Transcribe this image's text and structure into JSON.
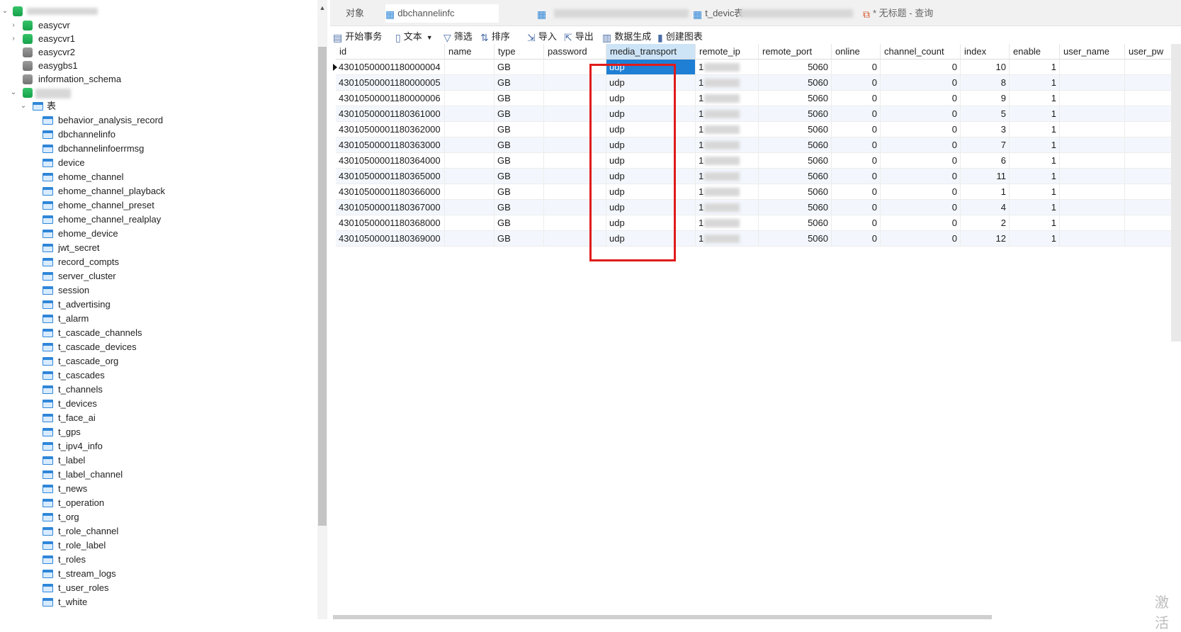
{
  "tabs": [
    {
      "label": "对象"
    },
    {
      "label": "dbchannelinfc"
    },
    {
      "label": "表"
    },
    {
      "label": "t_devic"
    },
    {
      "label": "* 无标题 - 查询"
    }
  ],
  "toolbar": {
    "begin_transaction": "开始事务",
    "text": "文本",
    "filter": "筛选",
    "sort": "排序",
    "import": "导入",
    "export": "导出",
    "generate_data": "数据生成",
    "create_chart": "创建图表"
  },
  "tree": {
    "databases": [
      "easycvr",
      "easycvr1",
      "easycvr2",
      "easygbs1",
      "information_schema"
    ],
    "tables_node": "表",
    "tables": [
      "behavior_analysis_record",
      "dbchannelinfo",
      "dbchannelinfoerrmsg",
      "device",
      "ehome_channel",
      "ehome_channel_playback",
      "ehome_channel_preset",
      "ehome_channel_realplay",
      "ehome_device",
      "jwt_secret",
      "record_compts",
      "server_cluster",
      "session",
      "t_advertising",
      "t_alarm",
      "t_cascade_channels",
      "t_cascade_devices",
      "t_cascade_org",
      "t_cascades",
      "t_channels",
      "t_devices",
      "t_face_ai",
      "t_gps",
      "t_ipv4_info",
      "t_label",
      "t_label_channel",
      "t_news",
      "t_operation",
      "t_org",
      "t_role_channel",
      "t_role_label",
      "t_roles",
      "t_stream_logs",
      "t_user_roles",
      "t_white"
    ]
  },
  "grid": {
    "columns": [
      "id",
      "name",
      "type",
      "password",
      "media_transport",
      "remote_ip",
      "remote_port",
      "online",
      "channel_count",
      "index",
      "enable",
      "user_name",
      "user_pw"
    ],
    "rows": [
      {
        "id": "43010500001180000004",
        "type": "GB",
        "media_transport": "udp",
        "remote_ip": "1",
        "remote_port": "5060",
        "online": "0",
        "channel_count": "0",
        "index": "10",
        "enable": "1"
      },
      {
        "id": "43010500001180000005",
        "type": "GB",
        "media_transport": "udp",
        "remote_ip": "1",
        "remote_port": "5060",
        "online": "0",
        "channel_count": "0",
        "index": "8",
        "enable": "1"
      },
      {
        "id": "43010500001180000006",
        "type": "GB",
        "media_transport": "udp",
        "remote_ip": "1",
        "remote_port": "5060",
        "online": "0",
        "channel_count": "0",
        "index": "9",
        "enable": "1"
      },
      {
        "id": "43010500001180361000",
        "type": "GB",
        "media_transport": "udp",
        "remote_ip": "1",
        "remote_port": "5060",
        "online": "0",
        "channel_count": "0",
        "index": "5",
        "enable": "1"
      },
      {
        "id": "43010500001180362000",
        "type": "GB",
        "media_transport": "udp",
        "remote_ip": "1",
        "remote_port": "5060",
        "online": "0",
        "channel_count": "0",
        "index": "3",
        "enable": "1"
      },
      {
        "id": "43010500001180363000",
        "type": "GB",
        "media_transport": "udp",
        "remote_ip": "1",
        "remote_port": "5060",
        "online": "0",
        "channel_count": "0",
        "index": "7",
        "enable": "1"
      },
      {
        "id": "43010500001180364000",
        "type": "GB",
        "media_transport": "udp",
        "remote_ip": "1",
        "remote_port": "5060",
        "online": "0",
        "channel_count": "0",
        "index": "6",
        "enable": "1"
      },
      {
        "id": "43010500001180365000",
        "type": "GB",
        "media_transport": "udp",
        "remote_ip": "1",
        "remote_port": "5060",
        "online": "0",
        "channel_count": "0",
        "index": "11",
        "enable": "1"
      },
      {
        "id": "43010500001180366000",
        "type": "GB",
        "media_transport": "udp",
        "remote_ip": "1",
        "remote_port": "5060",
        "online": "0",
        "channel_count": "0",
        "index": "1",
        "enable": "1"
      },
      {
        "id": "43010500001180367000",
        "type": "GB",
        "media_transport": "udp",
        "remote_ip": "1",
        "remote_port": "5060",
        "online": "0",
        "channel_count": "0",
        "index": "4",
        "enable": "1"
      },
      {
        "id": "43010500001180368000",
        "type": "GB",
        "media_transport": "udp",
        "remote_ip": "1",
        "remote_port": "5060",
        "online": "0",
        "channel_count": "0",
        "index": "2",
        "enable": "1"
      },
      {
        "id": "43010500001180369000",
        "type": "GB",
        "media_transport": "udp",
        "remote_ip": "1",
        "remote_port": "5060",
        "online": "0",
        "channel_count": "0",
        "index": "12",
        "enable": "1"
      }
    ]
  },
  "watermark": "激活",
  "colors": {
    "selected_cell": "#1f7fd4",
    "highlight_box": "#e01b1b",
    "row_alt": "#f3f7fd"
  }
}
